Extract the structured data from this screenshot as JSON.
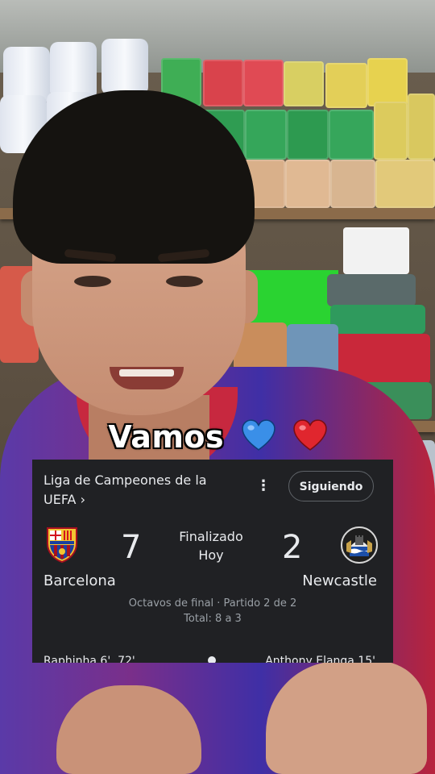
{
  "caption": {
    "text": "Vamos",
    "emojis": [
      "blue-heart",
      "red-heart"
    ],
    "colors": {
      "blue_heart": "#3a8fe8",
      "red_heart": "#e0262e"
    }
  },
  "match_card": {
    "competition": "Liga de Campeones de la UEFA ›",
    "menu_icon": "more-vert-icon",
    "follow_label": "Siguiendo",
    "home": {
      "name": "Barcelona",
      "score": "7",
      "crest": "fc-barcelona-crest"
    },
    "away": {
      "name": "Newcastle",
      "score": "2",
      "crest": "newcastle-crest"
    },
    "status": {
      "line1": "Finalizado",
      "line2": "Hoy"
    },
    "round": "Octavos de final · Partido 2 de 2",
    "aggregate": "Total: 8 a 3",
    "home_scorers": "Raphinha 6', 72'",
    "away_scorers": "Anthony Elanga 15'",
    "colors": {
      "background": "#202124",
      "text": "#e8eaed",
      "muted": "#9aa0a6"
    }
  }
}
